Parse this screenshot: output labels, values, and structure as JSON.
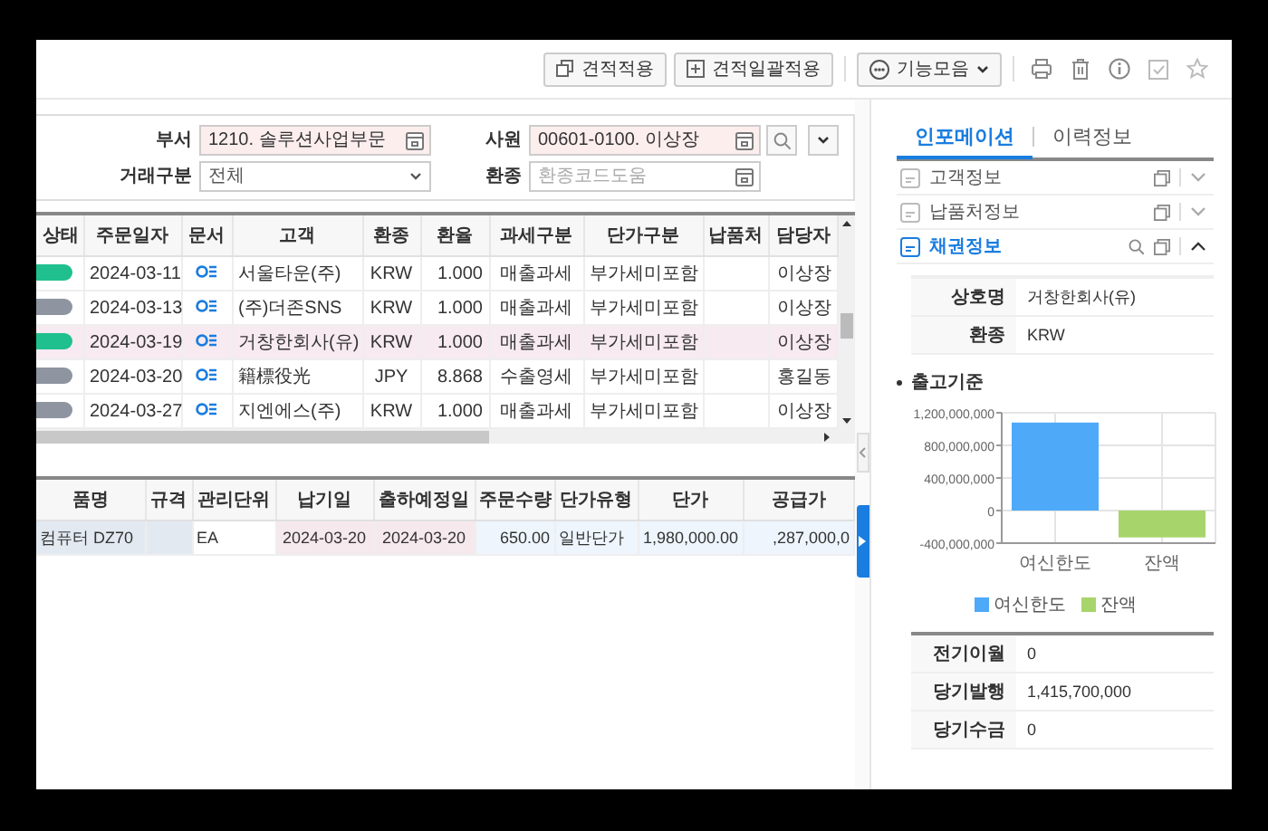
{
  "toolbar": {
    "buttons": [
      {
        "label": "견적적용",
        "kind": "copy"
      },
      {
        "label": "견적일괄적용",
        "kind": "add"
      },
      {
        "label": "기능모음",
        "kind": "menu"
      }
    ]
  },
  "filters": [
    {
      "label": "부서",
      "value": "1210. 솔루션사업부문",
      "kind": "lookup",
      "required": true
    },
    {
      "label": "사원",
      "value": "00601-0100. 이상장",
      "kind": "lookup",
      "required": true
    },
    {
      "label": "거래구분",
      "value": "전체",
      "kind": "select",
      "required": false
    },
    {
      "label": "환종",
      "placeholder": "환종코드도움",
      "kind": "lookup",
      "required": false
    }
  ],
  "orders": {
    "columns": [
      "상태",
      "주문일자",
      "문서",
      "고객",
      "환종",
      "환율",
      "과세구분",
      "단가구분",
      "납품처",
      "담당자"
    ],
    "rows": [
      {
        "on": true,
        "selected": false,
        "date": "2024-03-11",
        "customer": "서울타운(주)",
        "currency": "KRW",
        "rate": "1.000",
        "tax_type": "매출과세",
        "price_type": "부가세미포함",
        "manager": "이상장"
      },
      {
        "on": false,
        "selected": false,
        "date": "2024-03-13",
        "customer": "(주)더존SNS",
        "currency": "KRW",
        "rate": "1.000",
        "tax_type": "매출과세",
        "price_type": "부가세미포함",
        "manager": "이상장"
      },
      {
        "on": true,
        "selected": true,
        "date": "2024-03-19",
        "customer": "거창한회사(유)",
        "currency": "KRW",
        "rate": "1.000",
        "tax_type": "매출과세",
        "price_type": "부가세미포함",
        "manager": "이상장"
      },
      {
        "on": false,
        "selected": false,
        "date": "2024-03-20",
        "customer": "籍標役光",
        "currency": "JPY",
        "rate": "8.868",
        "tax_type": "수출영세",
        "price_type": "부가세미포함",
        "manager": "홍길동"
      },
      {
        "on": false,
        "selected": false,
        "date": "2024-03-27",
        "customer": "지엔에스(주)",
        "currency": "KRW",
        "rate": "1.000",
        "tax_type": "매출과세",
        "price_type": "부가세미포함",
        "manager": "이상장"
      }
    ]
  },
  "items": {
    "columns": [
      "품명",
      "규격",
      "관리단위",
      "납기일",
      "출하예정일",
      "주문수량",
      "단가유형",
      "단가",
      "공급가"
    ],
    "rows": [
      [
        "컴퓨터 DZ70",
        "",
        "EA",
        "2024-03-20",
        "2024-03-20",
        "650.00",
        "일반단가",
        "1,980,000.00",
        ",287,000,0"
      ]
    ]
  },
  "info_tabs": [
    {
      "label": "인포메이션",
      "selected": true
    },
    {
      "label": "이력정보",
      "selected": false
    }
  ],
  "sections": [
    {
      "label": "고객정보",
      "expanded": false
    },
    {
      "label": "납품처정보",
      "expanded": false
    },
    {
      "label": "채권정보",
      "expanded": true
    }
  ],
  "credit": {
    "fields": [
      {
        "label": "상호명",
        "value": "거창한회사(유)"
      },
      {
        "label": "환종",
        "value": "KRW"
      }
    ],
    "heading": "출고기준",
    "chart_data": {
      "type": "bar",
      "categories": [
        "여신한도",
        "잔액"
      ],
      "series": [
        {
          "name": "여신한도",
          "color": "#4ea9f8",
          "values": [
            1080000000,
            null
          ]
        },
        {
          "name": "잔액",
          "color": "#a7d56b",
          "values": [
            null,
            -330000000
          ]
        }
      ],
      "grid": true,
      "ylim": [
        -400000000,
        1200000000
      ],
      "yticks": [
        {
          "value": -400000000,
          "label": "-400,000,000"
        },
        {
          "value": 0,
          "label": "0"
        },
        {
          "value": 400000000,
          "label": "400,000,000"
        },
        {
          "value": 800000000,
          "label": "800,000,000"
        },
        {
          "value": 1200000000,
          "label": "1,200,000,000"
        }
      ]
    },
    "summary": [
      {
        "label": "전기이월",
        "value": "0"
      },
      {
        "label": "당기발행",
        "value": "1,415,700,000"
      },
      {
        "label": "당기수금",
        "value": "0"
      }
    ]
  }
}
